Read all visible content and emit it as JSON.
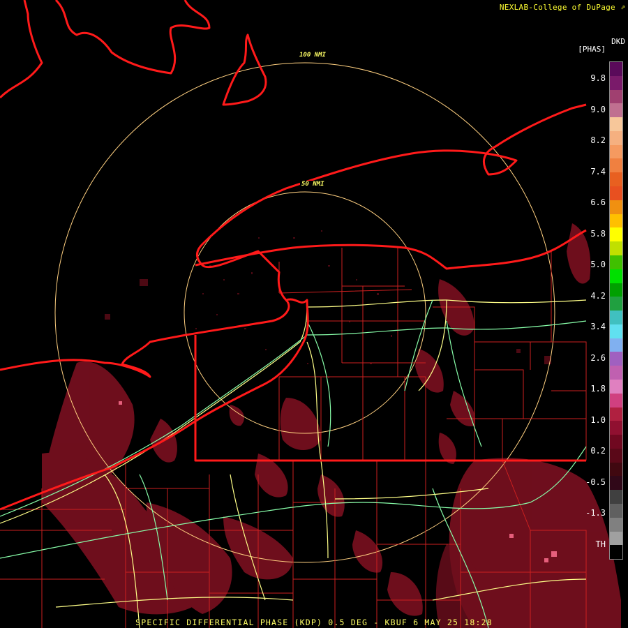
{
  "header": {
    "credit": "NEXLAB-College of DuPage",
    "credit_icon": "corner-arrow-icon"
  },
  "footer": {
    "caption": "SPECIFIC DIFFERENTIAL PHASE (KDP) 0.5 DEG - KBUF 6 MAY 25 18:28"
  },
  "range_rings": [
    {
      "label": "100 NMI",
      "range_nmi": 100
    },
    {
      "label": "50 NMI",
      "range_nmi": 50
    }
  ],
  "legend": {
    "unit_top": "DKD",
    "unit_bottom": "[PHAS]",
    "ticks": [
      "9.8",
      "9.0",
      "8.2",
      "7.4",
      "6.6",
      "5.8",
      "5.0",
      "4.2",
      "3.4",
      "2.6",
      "1.8",
      "1.0",
      "0.2",
      "-0.5",
      "-1.3",
      "TH"
    ],
    "colors": [
      "#5a0a5a",
      "#7a1a6a",
      "#a04070",
      "#c07090",
      "#f7c79a",
      "#f5b080",
      "#f59a60",
      "#f08040",
      "#e86020",
      "#e85020",
      "#f09010",
      "#ffc000",
      "#ffff00",
      "#c0e000",
      "#40c000",
      "#00e000",
      "#00a000",
      "#20a040",
      "#40c0c0",
      "#60e0f0",
      "#80b0f0",
      "#a060c0",
      "#c060b0",
      "#e080c0",
      "#d04080",
      "#b02040",
      "#901030",
      "#700820",
      "#5a0818",
      "#400810",
      "#300818",
      "#404040",
      "#606060",
      "#808080",
      "#a0a0a0",
      "#000000"
    ]
  },
  "colors": {
    "border": "#ff1a1a",
    "county": "#cc2020",
    "highway_yellow": "#ffff88",
    "highway_green": "#88ffaa",
    "echo": "#7a1020",
    "ring": "#ffd080"
  }
}
